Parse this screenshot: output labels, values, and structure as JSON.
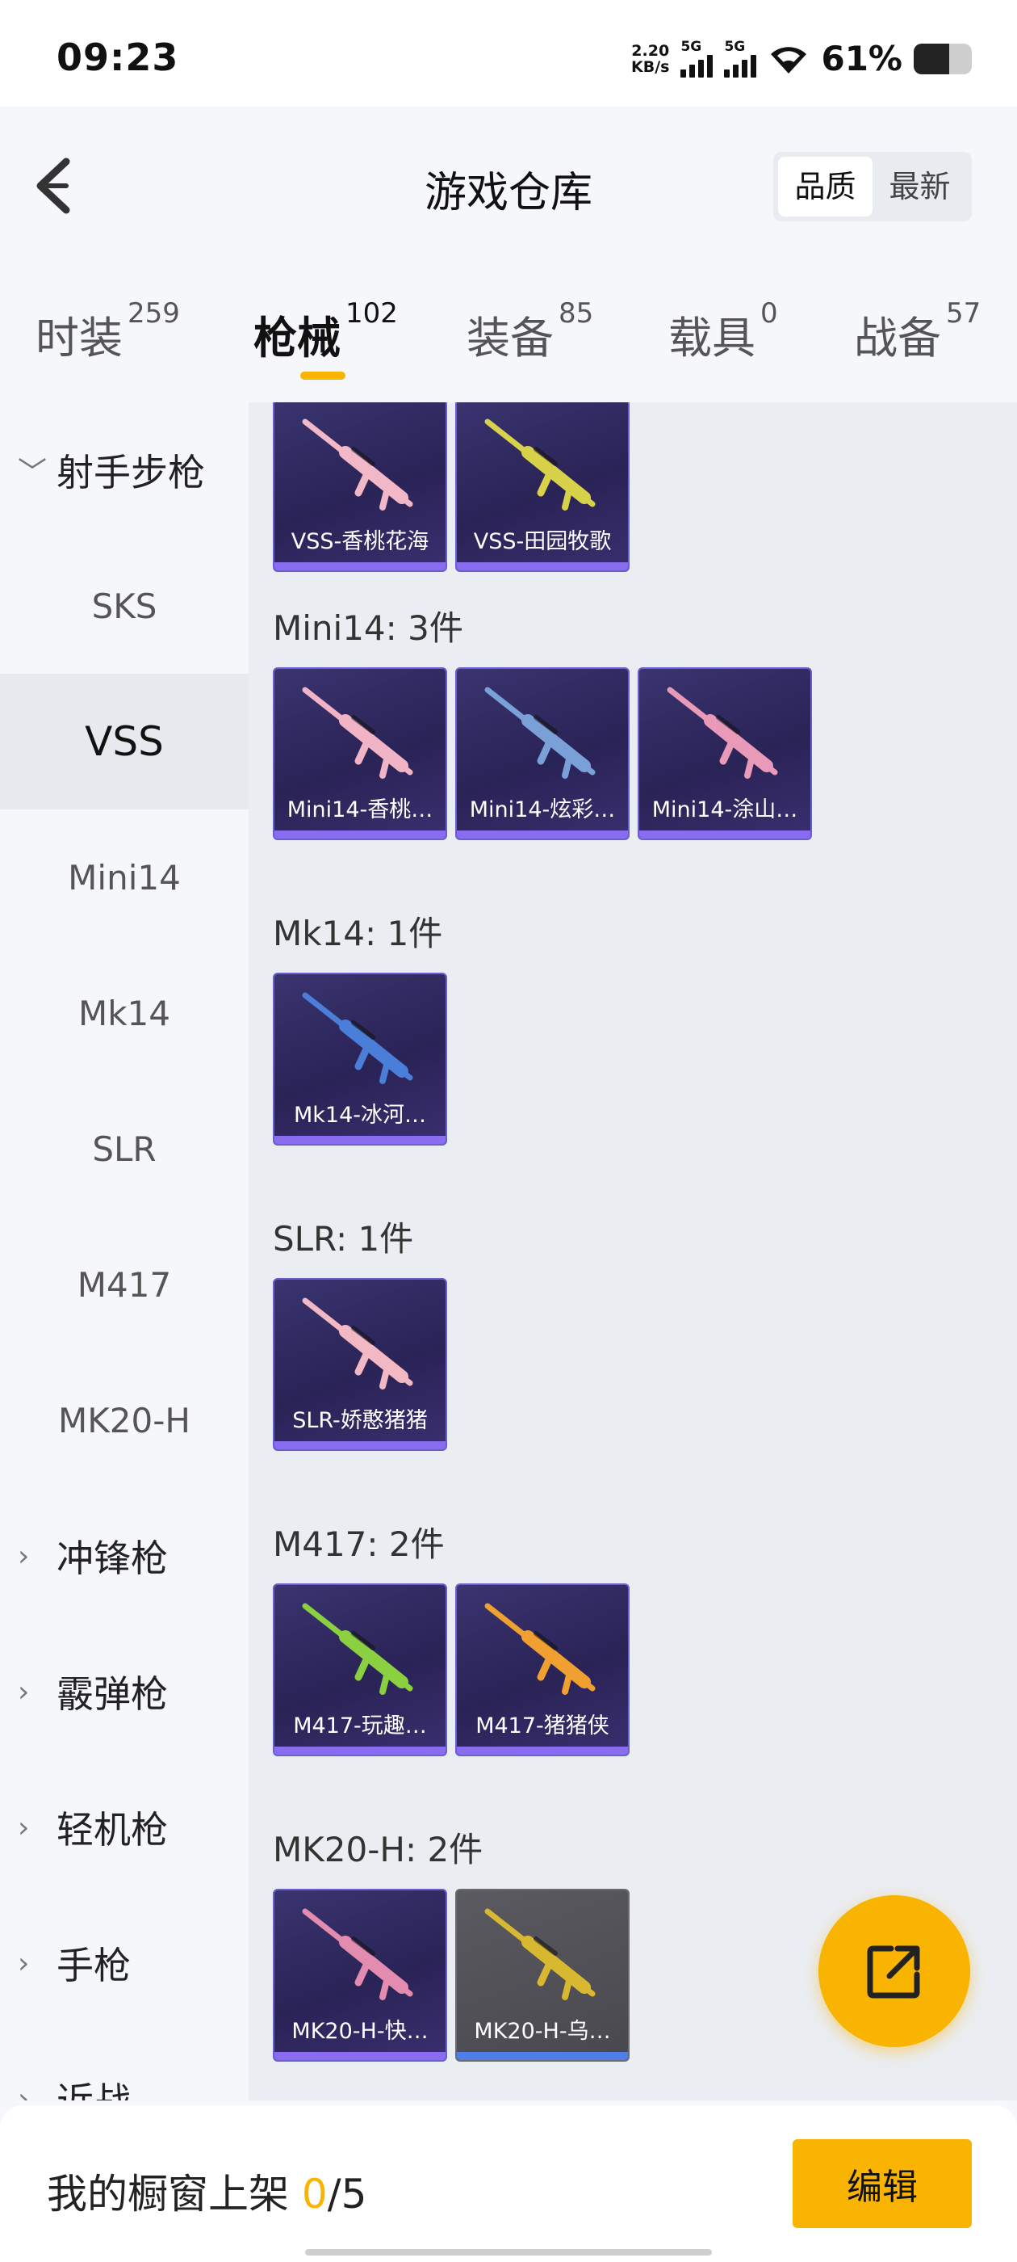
{
  "status_bar": {
    "time": "09:23",
    "net_speed_value": "2.20",
    "net_speed_unit": "KB/s",
    "sim1": "5G",
    "sim2": "5G",
    "battery_percent": "61%",
    "battery_level": 0.61
  },
  "header": {
    "title": "游戏仓库",
    "sort_options": [
      "品质",
      "最新"
    ],
    "sort_selected": "品质",
    "back_icon": "chevron-left-icon"
  },
  "tabs": [
    {
      "label": "时装",
      "count": "259"
    },
    {
      "label": "枪械",
      "count": "102",
      "active": true
    },
    {
      "label": "装备",
      "count": "85"
    },
    {
      "label": "载具",
      "count": "0"
    },
    {
      "label": "战备",
      "count": "57"
    }
  ],
  "sidebar": {
    "items": [
      {
        "label": "射手步枪",
        "type": "category",
        "expanded": true
      },
      {
        "label": "SKS",
        "type": "sub"
      },
      {
        "label": "VSS",
        "type": "sub",
        "selected": true
      },
      {
        "label": "Mini14",
        "type": "sub"
      },
      {
        "label": "Mk14",
        "type": "sub"
      },
      {
        "label": "SLR",
        "type": "sub"
      },
      {
        "label": "M417",
        "type": "sub"
      },
      {
        "label": "MK20-H",
        "type": "sub"
      },
      {
        "label": "冲锋枪",
        "type": "category"
      },
      {
        "label": "霰弹枪",
        "type": "category"
      },
      {
        "label": "轻机枪",
        "type": "category"
      },
      {
        "label": "手枪",
        "type": "category"
      },
      {
        "label": "近战",
        "type": "category"
      }
    ]
  },
  "sections": [
    {
      "title": "",
      "items": [
        {
          "name": "VSS-香桃花海",
          "gun_color": "#f2b8c8"
        },
        {
          "name": "VSS-田园牧歌",
          "gun_color": "#d8d24a"
        }
      ]
    },
    {
      "title": "Mini14: 3件",
      "items": [
        {
          "name": "Mini14-香桃…",
          "gun_color": "#f0b4c6"
        },
        {
          "name": "Mini14-炫彩…",
          "gun_color": "#7aa0d8"
        },
        {
          "name": "Mini14-涂山…",
          "gun_color": "#e89ab8"
        }
      ]
    },
    {
      "title": "Mk14: 1件",
      "items": [
        {
          "name": "Mk14-冰河…",
          "gun_color": "#4a7ed8"
        }
      ]
    },
    {
      "title": "SLR: 1件",
      "items": [
        {
          "name": "SLR-娇憨猪猪",
          "gun_color": "#f2b8c4"
        }
      ]
    },
    {
      "title": "M417: 2件",
      "items": [
        {
          "name": "M417-玩趣…",
          "gun_color": "#8ad040"
        },
        {
          "name": "M417-猪猪侠",
          "gun_color": "#f0a030"
        }
      ]
    },
    {
      "title": "MK20-H: 2件",
      "items": [
        {
          "name": "MK20-H-快…",
          "gun_color": "#e48cb0"
        },
        {
          "name": "MK20-H-乌…",
          "gun_color": "#d8b830",
          "gray": true
        }
      ]
    }
  ],
  "fab": {
    "icon": "share-external-icon",
    "color": "#f8b400"
  },
  "bottom_bar": {
    "showcase_label": "我的橱窗上架",
    "showcase_current": "0",
    "showcase_total": "/5",
    "edit_label": "编辑"
  }
}
